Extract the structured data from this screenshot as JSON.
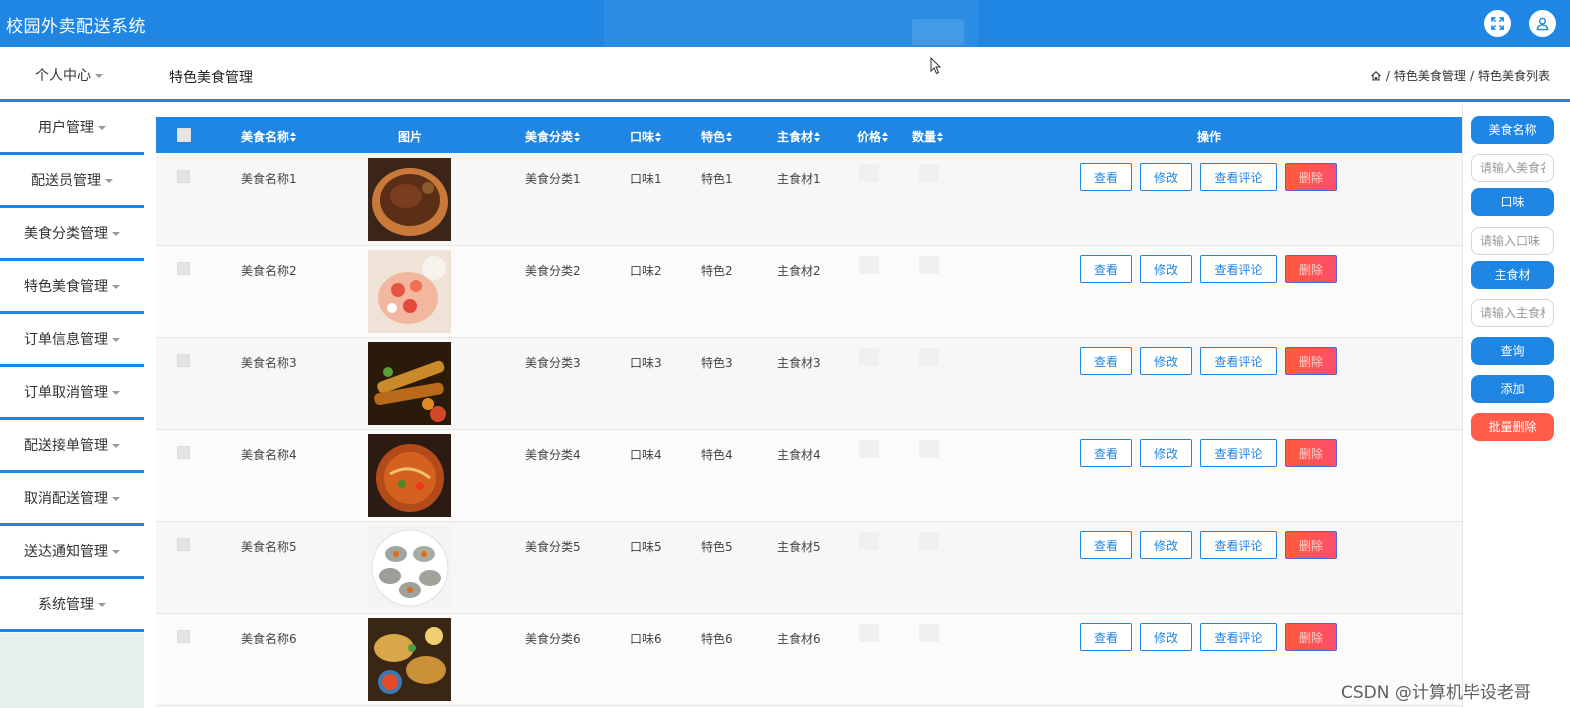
{
  "header": {
    "app_title": "校园外卖配送系统",
    "icons": [
      "fullscreen-icon",
      "user-icon"
    ]
  },
  "subheader": {
    "personal_center": "个人中心",
    "page_title": "特色美食管理",
    "breadcrumb": [
      "特色美食管理",
      "特色美食列表"
    ],
    "breadcrumb_sep": "/"
  },
  "sidebar": {
    "items": [
      {
        "label": "用户管理"
      },
      {
        "label": "配送员管理"
      },
      {
        "label": "美食分类管理"
      },
      {
        "label": "特色美食管理"
      },
      {
        "label": "订单信息管理"
      },
      {
        "label": "订单取消管理"
      },
      {
        "label": "配送接单管理"
      },
      {
        "label": "取消配送管理"
      },
      {
        "label": "送达通知管理"
      },
      {
        "label": "系统管理"
      }
    ]
  },
  "table": {
    "headers": {
      "name": "美食名称",
      "image": "图片",
      "category": "美食分类",
      "taste": "口味",
      "feature": "特色",
      "ingredient": "主食材",
      "price": "价格",
      "quantity": "数量",
      "actions": "操作"
    },
    "rows": [
      {
        "name": "美食名称1",
        "category": "美食分类1",
        "taste": "口味1",
        "feature": "特色1",
        "ingredient": "主食材1",
        "image": "grilled-steak-photo"
      },
      {
        "name": "美食名称2",
        "category": "美食分类2",
        "taste": "口味2",
        "feature": "特色2",
        "ingredient": "主食材2",
        "image": "cake-dessert-photo"
      },
      {
        "name": "美食名称3",
        "category": "美食分类3",
        "taste": "口味3",
        "feature": "特色3",
        "ingredient": "主食材3",
        "image": "skewers-photo"
      },
      {
        "name": "美食名称4",
        "category": "美食分类4",
        "taste": "口味4",
        "feature": "特色4",
        "ingredient": "主食材4",
        "image": "spicy-noodle-bowl-photo"
      },
      {
        "name": "美食名称5",
        "category": "美食分类5",
        "taste": "口味5",
        "feature": "特色5",
        "ingredient": "主食材5",
        "image": "oysters-plate-photo"
      },
      {
        "name": "美食名称6",
        "category": "美食分类6",
        "taste": "口味6",
        "feature": "特色6",
        "ingredient": "主食材6",
        "image": "tacos-spread-photo"
      }
    ],
    "buttons": {
      "view": "查看",
      "edit": "修改",
      "comments": "查看评论",
      "delete": "删除"
    }
  },
  "search_panel": {
    "name_label": "美食名称",
    "name_placeholder": "请输入美食名称",
    "taste_label": "口味",
    "taste_placeholder": "请输入口味",
    "ingredient_label": "主食材",
    "ingredient_placeholder": "请输入主食材",
    "query_button": "查询",
    "add_button": "添加",
    "batch_delete_button": "批量删除"
  },
  "watermark": "CSDN @计算机毕设老哥",
  "colors": {
    "primary": "#1f86e4",
    "danger": "#ff5c4a",
    "sidebar_bottom": "#e4f1ec"
  }
}
